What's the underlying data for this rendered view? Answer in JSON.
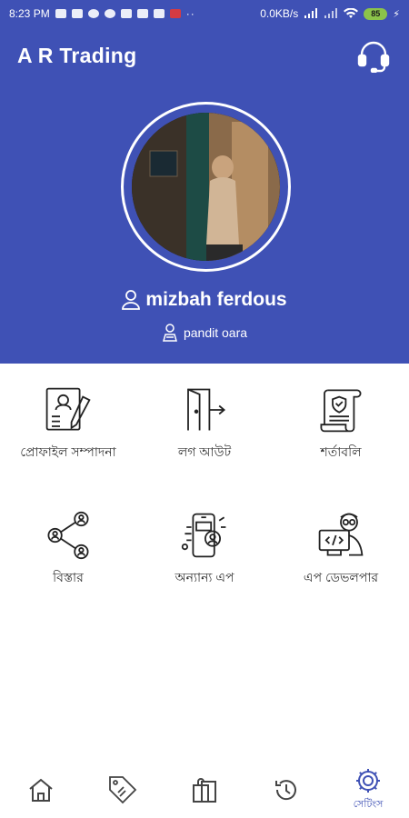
{
  "status_bar": {
    "time": "8:23 PM",
    "network_speed": "0.0KB/s",
    "battery": "85"
  },
  "app_bar": {
    "title": "A R Trading",
    "support_icon": "headset-icon"
  },
  "profile": {
    "name": "mizbah ferdous",
    "location": "pandit oara"
  },
  "menu": [
    {
      "label": "প্রোফাইল সম্পাদনা",
      "icon": "edit-profile-icon"
    },
    {
      "label": "লগ আউট",
      "icon": "logout-door-icon"
    },
    {
      "label": "শর্তাবলি",
      "icon": "terms-scroll-icon"
    },
    {
      "label": "বিস্তার",
      "icon": "share-network-icon"
    },
    {
      "label": "অন্যান্য এপ",
      "icon": "other-apps-phone-icon"
    },
    {
      "label": "এপ ডেভলপার",
      "icon": "developer-icon"
    }
  ],
  "bottom_nav": [
    {
      "icon": "home-icon"
    },
    {
      "icon": "sale-tag-icon"
    },
    {
      "icon": "shopping-bag-icon"
    },
    {
      "icon": "history-clock-icon"
    },
    {
      "icon": "settings-gear-icon",
      "label": "সেটিংস",
      "active": true
    }
  ],
  "colors": {
    "primary": "#3f51b5",
    "battery": "#8bc34a",
    "icon_stroke": "#222222"
  }
}
